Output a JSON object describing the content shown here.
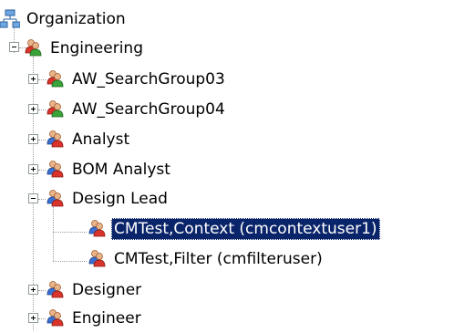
{
  "tree": {
    "root": {
      "label": "Organization",
      "icon": "organization-icon"
    },
    "nodes": [
      {
        "label": "Engineering",
        "icon": "group-icon",
        "state": "expanded"
      },
      {
        "label": "AW_SearchGroup03",
        "icon": "group-icon",
        "state": "collapsed"
      },
      {
        "label": "AW_SearchGroup04",
        "icon": "group-icon",
        "state": "collapsed"
      },
      {
        "label": "Analyst",
        "icon": "role-icon",
        "state": "collapsed"
      },
      {
        "label": "BOM Analyst",
        "icon": "role-icon",
        "state": "collapsed"
      },
      {
        "label": "Design Lead",
        "icon": "role-icon",
        "state": "expanded"
      },
      {
        "label": "CMTest,Context (cmcontextuser1)",
        "icon": "user-icon",
        "state": "leaf",
        "selected": true
      },
      {
        "label": "CMTest,Filter (cmfilteruser)",
        "icon": "user-icon",
        "state": "leaf",
        "selected": false
      },
      {
        "label": "Designer",
        "icon": "role-icon",
        "state": "collapsed"
      },
      {
        "label": "Engineer",
        "icon": "role-icon",
        "state": "collapsed"
      }
    ]
  },
  "colors": {
    "selection_bg": "#0a246a",
    "selection_text": "#ffffff",
    "connector_line": "#a0a0a0",
    "expander_border": "#919b9c"
  }
}
